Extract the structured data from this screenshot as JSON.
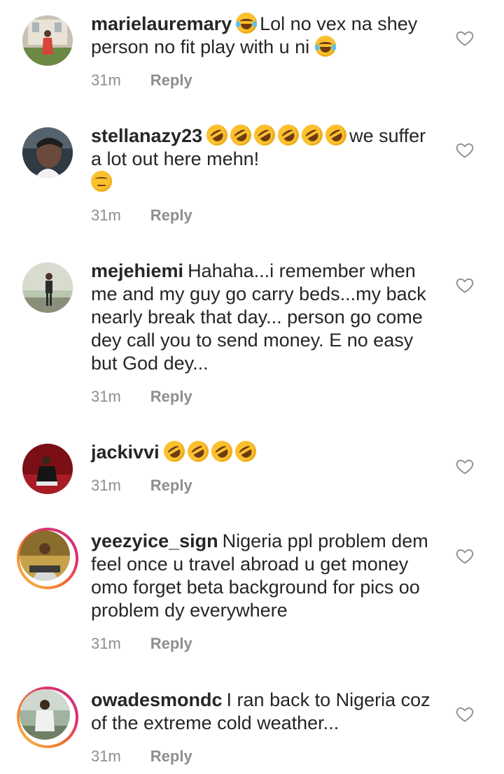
{
  "comments": [
    {
      "username": "marielauremary",
      "text_a": "Lol no vex na shey person no fit play with u ni",
      "time": "31m",
      "reply_label": "Reply"
    },
    {
      "username": "stellanazy23",
      "text_a": "we suffer a lot out here mehn!",
      "time": "31m",
      "reply_label": "Reply"
    },
    {
      "username": "mejehiemi",
      "text_a": "Hahaha...i remember when me and my guy go carry beds...my back nearly break that day... person go come dey call you to send money. E no easy but God dey...",
      "time": "31m",
      "reply_label": "Reply"
    },
    {
      "username": "jackivvi",
      "time": "31m",
      "reply_label": "Reply"
    },
    {
      "username": "yeezyice_sign",
      "text_a": "Nigeria ppl problem dem feel once u travel abroad u get money omo forget beta background for pics oo problem dy everywhere",
      "time": "31m",
      "reply_label": "Reply"
    },
    {
      "username": "owadesmondc",
      "text_a": "I ran back to Nigeria coz of the extreme cold weather...",
      "time": "31m",
      "reply_label": "Reply"
    }
  ],
  "icons": {
    "heart": "heart-outline-icon",
    "joy": "face-with-tears-of-joy-emoji",
    "rofl": "rolling-on-floor-laughing-emoji",
    "pensive": "pensive-face-emoji"
  },
  "colors": {
    "text": "#262626",
    "meta": "#8e8e8e",
    "emoji": "#fbc02d"
  }
}
